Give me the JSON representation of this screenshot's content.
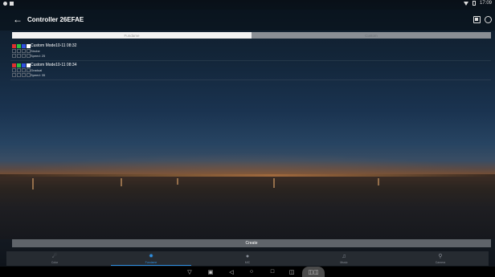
{
  "status_bar": {
    "time": "17:09"
  },
  "app_bar": {
    "title": "Controller  26EFAE"
  },
  "tabs": [
    {
      "label": "Fundame",
      "active": true
    },
    {
      "label": "Custom",
      "active": false
    }
  ],
  "modes": [
    {
      "name": "Custom Mode10-11 08:32",
      "effect": "Strobe",
      "speed": "Speed: 25",
      "swatches": [
        "#e03030",
        "#30c040",
        "#3050e0",
        "#ffffff",
        "",
        "",
        "",
        "",
        "",
        "",
        "",
        ""
      ]
    },
    {
      "name": "Custom Mode10-11 08:34",
      "effect": "Gradual",
      "speed": "Speed: 35",
      "swatches": [
        "#e03030",
        "#30c040",
        "#3050e0",
        "#ffffff",
        "",
        "",
        "",
        "",
        "",
        "",
        "",
        ""
      ]
    }
  ],
  "create_label": "Create",
  "bottom_nav": [
    {
      "label": "Color",
      "icon": "color-icon",
      "active": false
    },
    {
      "label": "Fundame",
      "icon": "fundamental-icon",
      "active": true
    },
    {
      "label": "MIC",
      "icon": "mic-icon",
      "active": false
    },
    {
      "label": "Music",
      "icon": "music-icon",
      "active": false
    },
    {
      "label": "Camera",
      "icon": "camera-icon",
      "active": false
    }
  ],
  "colors": {
    "accent": "#2f8fe0",
    "tab_active": "#f2f2f2",
    "tab_inactive": "#8a8f95",
    "create_bg": "#5f646a",
    "nav_bg": "#262b31"
  }
}
